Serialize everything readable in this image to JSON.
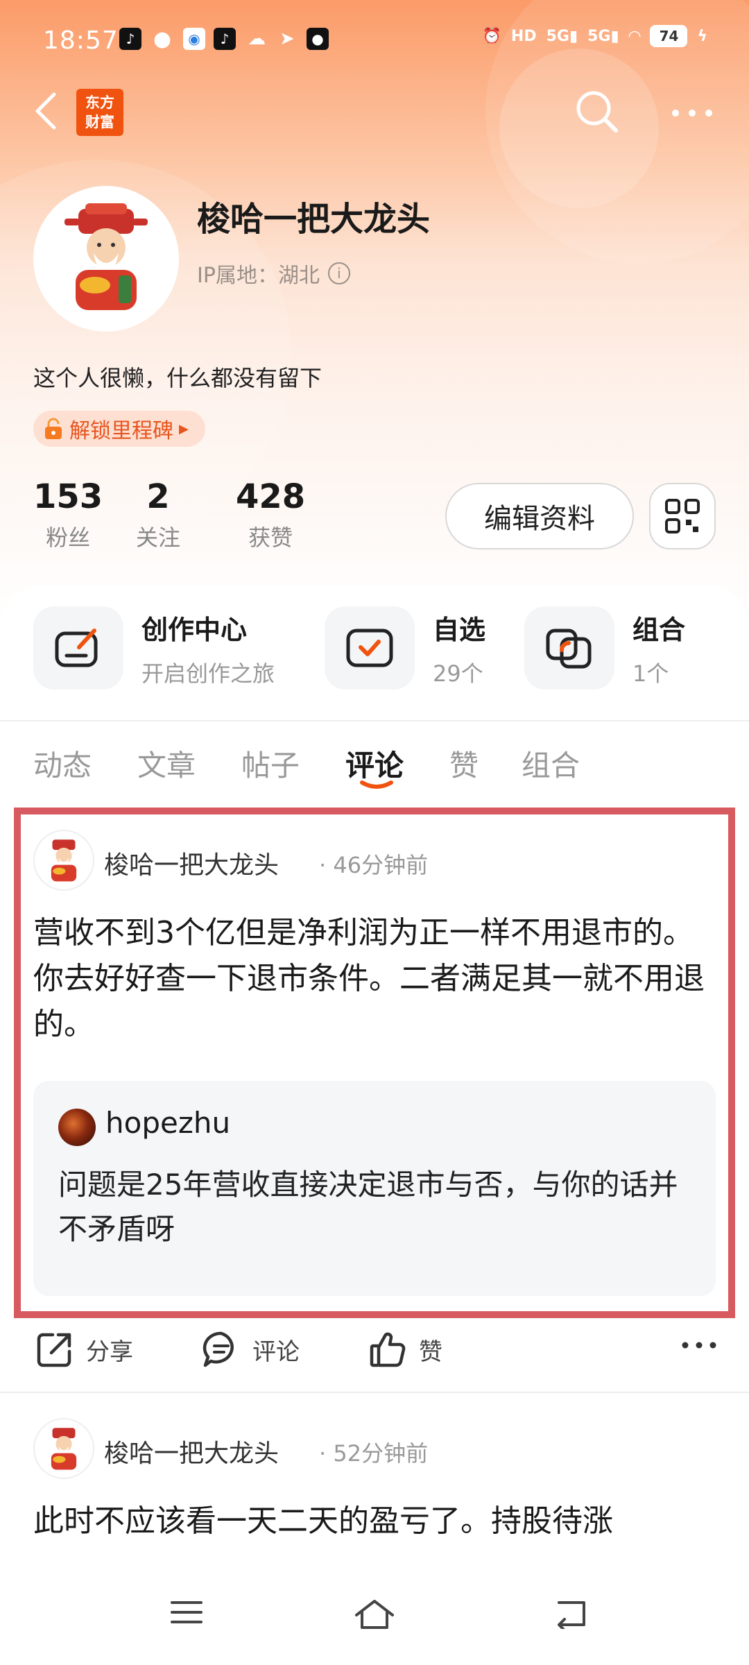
{
  "status_bar": {
    "time": "18:57",
    "battery": "74",
    "network": "5G"
  },
  "nav": {
    "logo_text_line1": "东方",
    "logo_text_line2": "财富"
  },
  "profile": {
    "username": "梭哈一把大龙头",
    "ip_location": "IP属地：湖北",
    "bio": "这个人很懒，什么都没有留下",
    "milestone_label": "解锁里程碑"
  },
  "stats": [
    {
      "value": "153",
      "label": "粉丝"
    },
    {
      "value": "2",
      "label": "关注"
    },
    {
      "value": "428",
      "label": "获赞"
    }
  ],
  "edit_profile_label": "编辑资料",
  "features": [
    {
      "title": "创作中心",
      "subtitle": "开启创作之旅",
      "icon": "create-center-icon"
    },
    {
      "title": "自选",
      "subtitle": "29个",
      "icon": "watchlist-icon"
    },
    {
      "title": "组合",
      "subtitle": "1个",
      "icon": "portfolio-icon"
    }
  ],
  "tabs": [
    {
      "label": "动态",
      "active": false
    },
    {
      "label": "文章",
      "active": false
    },
    {
      "label": "帖子",
      "active": false
    },
    {
      "label": "评论",
      "active": true
    },
    {
      "label": "赞",
      "active": false
    },
    {
      "label": "组合",
      "active": false
    }
  ],
  "comments": [
    {
      "user": "梭哈一把大龙头",
      "time": "· 46分钟前",
      "text": "营收不到3个亿但是净利润为正一样不用退市的。你去好好查一下退市条件。二者满足其一就不用退的。",
      "quote": {
        "user": "hopezhu",
        "text": "问题是25年营收直接决定退市与否，与你的话并不矛盾呀"
      }
    },
    {
      "user": "梭哈一把大龙头",
      "time": "· 52分钟前",
      "text": "此时不应该看一天二天的盈亏了。持股待涨"
    }
  ],
  "actions": {
    "share": "分享",
    "comment": "评论",
    "like": "赞"
  },
  "colors": {
    "accent": "#f0530f",
    "highlight_border": "#d65a5f",
    "header_gradient_top": "#fb9b68"
  }
}
